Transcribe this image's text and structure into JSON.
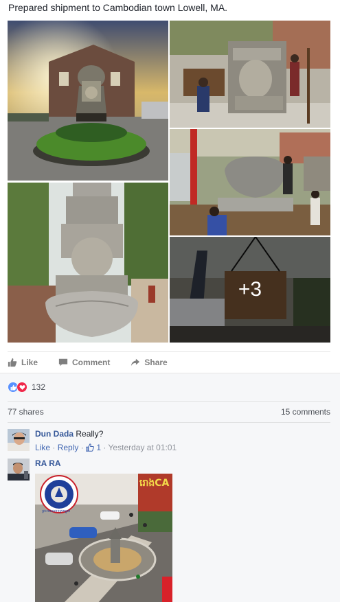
{
  "post": {
    "text": "Prepared shipment to Cambodian town Lowell, MA.",
    "more_photos_label": "+3"
  },
  "actions": {
    "like": "Like",
    "comment": "Comment",
    "share": "Share"
  },
  "feedback": {
    "reaction_count": "132",
    "reaction_icons": [
      "like-icon",
      "love-icon"
    ],
    "shares": "77 shares",
    "comments": "15 comments"
  },
  "comments": [
    {
      "author": "Dun Dada",
      "text": "Really?",
      "like_label": "Like",
      "reply_label": "Reply",
      "likes": "1",
      "time": "Yesterday at 01:01"
    },
    {
      "author": "RA RA",
      "attachment_caption": "ព្រះរាជាណាចក្រកម្ពុជា",
      "attachment_banner": "រោងCA"
    }
  ],
  "colors": {
    "link": "#365899",
    "meta_link": "#4267b2",
    "muted": "#90949c",
    "like_blue": "#5890ff",
    "love_red": "#f0284a"
  }
}
